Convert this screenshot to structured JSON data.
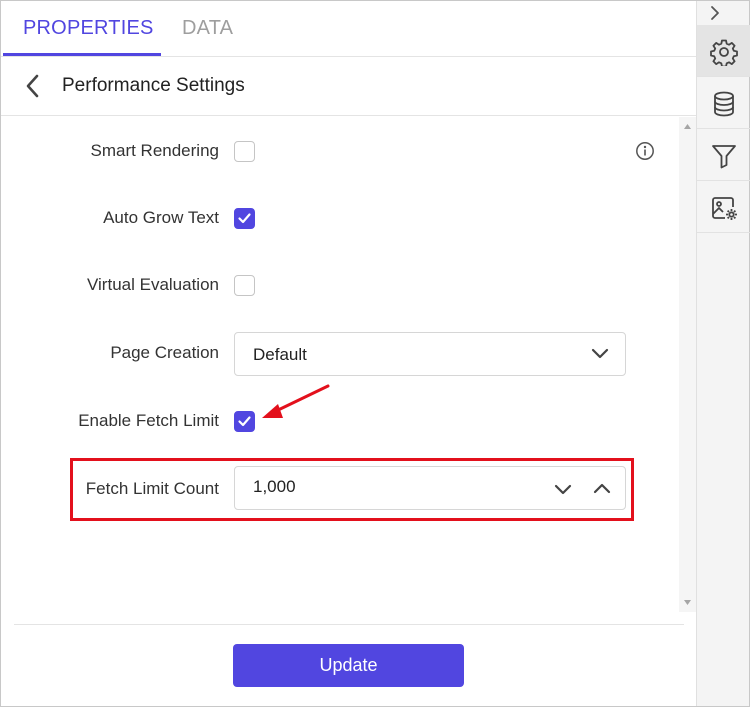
{
  "tabs": [
    {
      "label": "PROPERTIES",
      "active": true
    },
    {
      "label": "DATA",
      "active": false
    }
  ],
  "header": {
    "title": "Performance Settings"
  },
  "settings": {
    "smart_rendering": {
      "label": "Smart Rendering",
      "checked": false
    },
    "auto_grow_text": {
      "label": "Auto Grow Text",
      "checked": true
    },
    "virtual_evaluation": {
      "label": "Virtual Evaluation",
      "checked": false
    },
    "page_creation": {
      "label": "Page Creation",
      "value": "Default"
    },
    "enable_fetch_limit": {
      "label": "Enable Fetch Limit",
      "checked": true
    },
    "fetch_limit_count": {
      "label": "Fetch Limit Count",
      "value": "1,000"
    }
  },
  "footer": {
    "update_label": "Update"
  },
  "rail": {
    "items": [
      {
        "icon": "gear-icon",
        "active": true
      },
      {
        "icon": "database-icon",
        "active": false
      },
      {
        "icon": "filter-icon",
        "active": false
      },
      {
        "icon": "image-settings-icon",
        "active": false
      }
    ]
  },
  "colors": {
    "accent": "#5146e0",
    "annotation": "#e3101c"
  }
}
